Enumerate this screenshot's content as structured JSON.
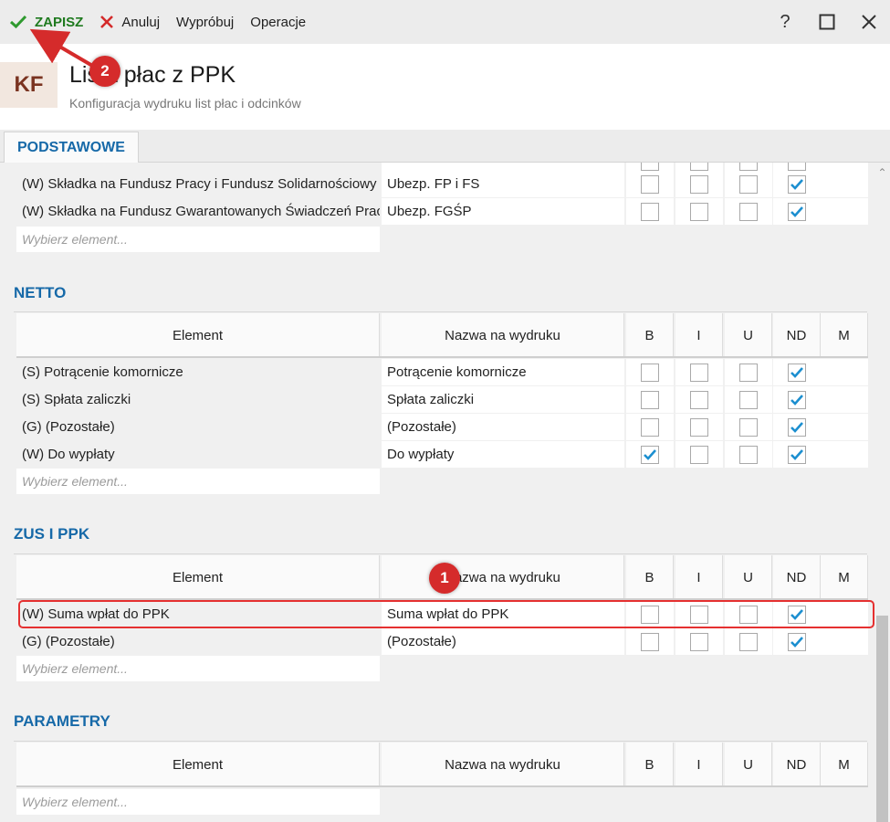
{
  "toolbar": {
    "save_label": "ZAPISZ",
    "cancel_label": "Anuluj",
    "try_label": "Wypróbuj",
    "operations_label": "Operacje",
    "help_label": "?"
  },
  "header": {
    "avatar": "KF",
    "title": "Lista płac z PPK",
    "subtitle": "Konfiguracja wydruku list płac i odcinków"
  },
  "tabs": [
    "PODSTAWOWE"
  ],
  "columns": {
    "element": "Element",
    "name": "Nazwa na wydruku",
    "b": "B",
    "i": "I",
    "u": "U",
    "nd": "ND",
    "m": "M"
  },
  "picker_placeholder": "Wybierz element...",
  "sections": {
    "top": {
      "rows": [
        {
          "element": "(W) Składka na Fundusz Pracy i Fundusz Solidarnościowy",
          "name": "Ubezp. FP i FS",
          "b": false,
          "i": false,
          "u": false,
          "nd": true
        },
        {
          "element": "(W) Składka na Fundusz Gwarantowanych Świadczeń Pracowniczych",
          "name": "Ubezp. FGŚP",
          "b": false,
          "i": false,
          "u": false,
          "nd": true
        }
      ]
    },
    "netto": {
      "title": "NETTO",
      "rows": [
        {
          "element": "(S) Potrącenie komornicze",
          "name": "Potrącenie komornicze",
          "b": false,
          "i": false,
          "u": false,
          "nd": true
        },
        {
          "element": "(S) Spłata zaliczki",
          "name": "Spłata zaliczki",
          "b": false,
          "i": false,
          "u": false,
          "nd": true
        },
        {
          "element": "(G) (Pozostałe)",
          "name": "(Pozostałe)",
          "b": false,
          "i": false,
          "u": false,
          "nd": true
        },
        {
          "element": "(W) Do wypłaty",
          "name": "Do wypłaty",
          "b": true,
          "i": false,
          "u": false,
          "nd": true
        }
      ]
    },
    "zus": {
      "title": "ZUS I PPK",
      "rows": [
        {
          "element": "(W) Suma wpłat do PPK",
          "name": "Suma wpłat do PPK",
          "b": false,
          "i": false,
          "u": false,
          "nd": true
        },
        {
          "element": "(G) (Pozostałe)",
          "name": "(Pozostałe)",
          "b": false,
          "i": false,
          "u": false,
          "nd": true
        }
      ]
    },
    "parametry": {
      "title": "PARAMETRY",
      "rows": []
    }
  },
  "annotations": [
    "1",
    "2"
  ],
  "colors": {
    "accent": "#1669a8",
    "save_green": "#1f7a1f",
    "check_blue": "#1c8fd0",
    "annotation_red": "#e53030"
  }
}
